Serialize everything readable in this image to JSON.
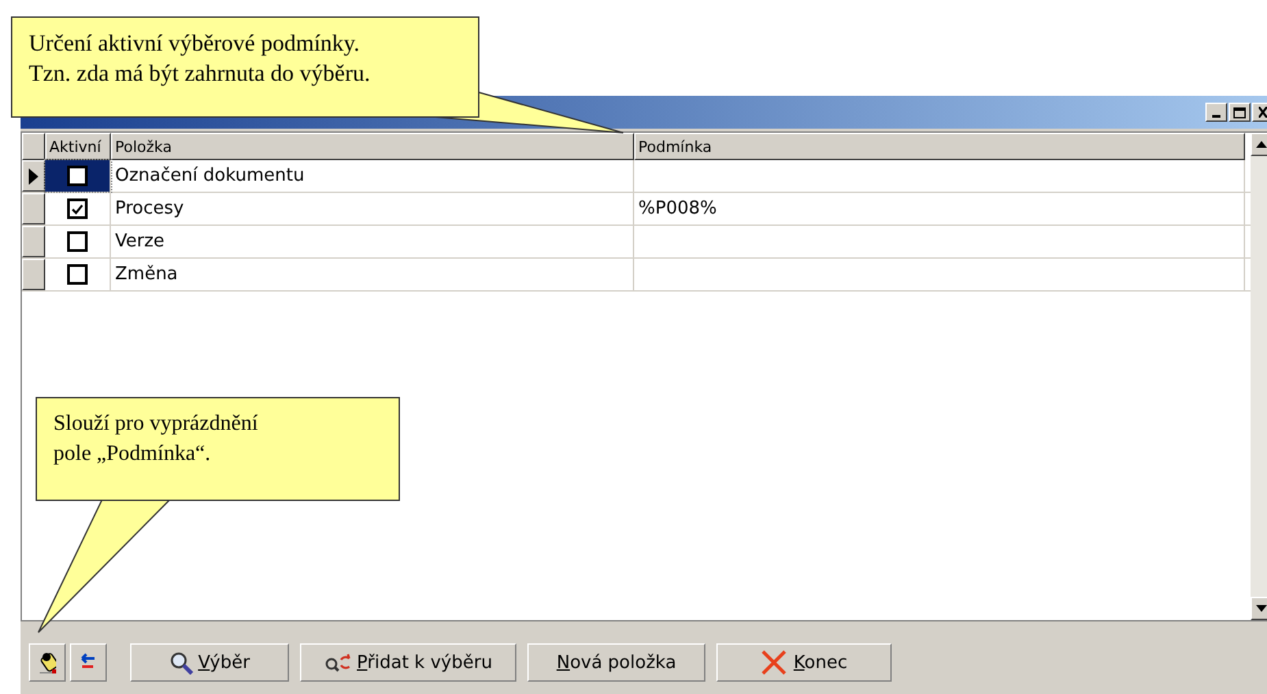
{
  "callouts": [
    {
      "text": "Určení aktivní výběrové podmínky.\nTzn. zda má být zahrnuta do výběru.",
      "kind": "top"
    },
    {
      "text": "Slouží pro vyprázdnění\npole „Podmínka“.",
      "kind": "bottom"
    }
  ],
  "table": {
    "columns": [
      "Aktivní",
      "Položka",
      "Podmínka"
    ],
    "rows": [
      {
        "selected": true,
        "active": false,
        "item": "Označení dokumentu",
        "condition": ""
      },
      {
        "selected": false,
        "active": true,
        "item": "Procesy",
        "condition": "%P008%"
      },
      {
        "selected": false,
        "active": false,
        "item": "Verze",
        "condition": ""
      },
      {
        "selected": false,
        "active": false,
        "item": "Změna",
        "condition": ""
      }
    ]
  },
  "toolbar": {
    "icon_buttons": [
      {
        "kind": "clear"
      },
      {
        "kind": "columns"
      }
    ],
    "buttons": [
      {
        "label": "Výběr",
        "kind": "search"
      },
      {
        "label": "Přidat k výběru",
        "kind": "add"
      },
      {
        "label": "Nová položka",
        "kind": "plain"
      },
      {
        "label": "Konec",
        "kind": "close"
      }
    ]
  }
}
